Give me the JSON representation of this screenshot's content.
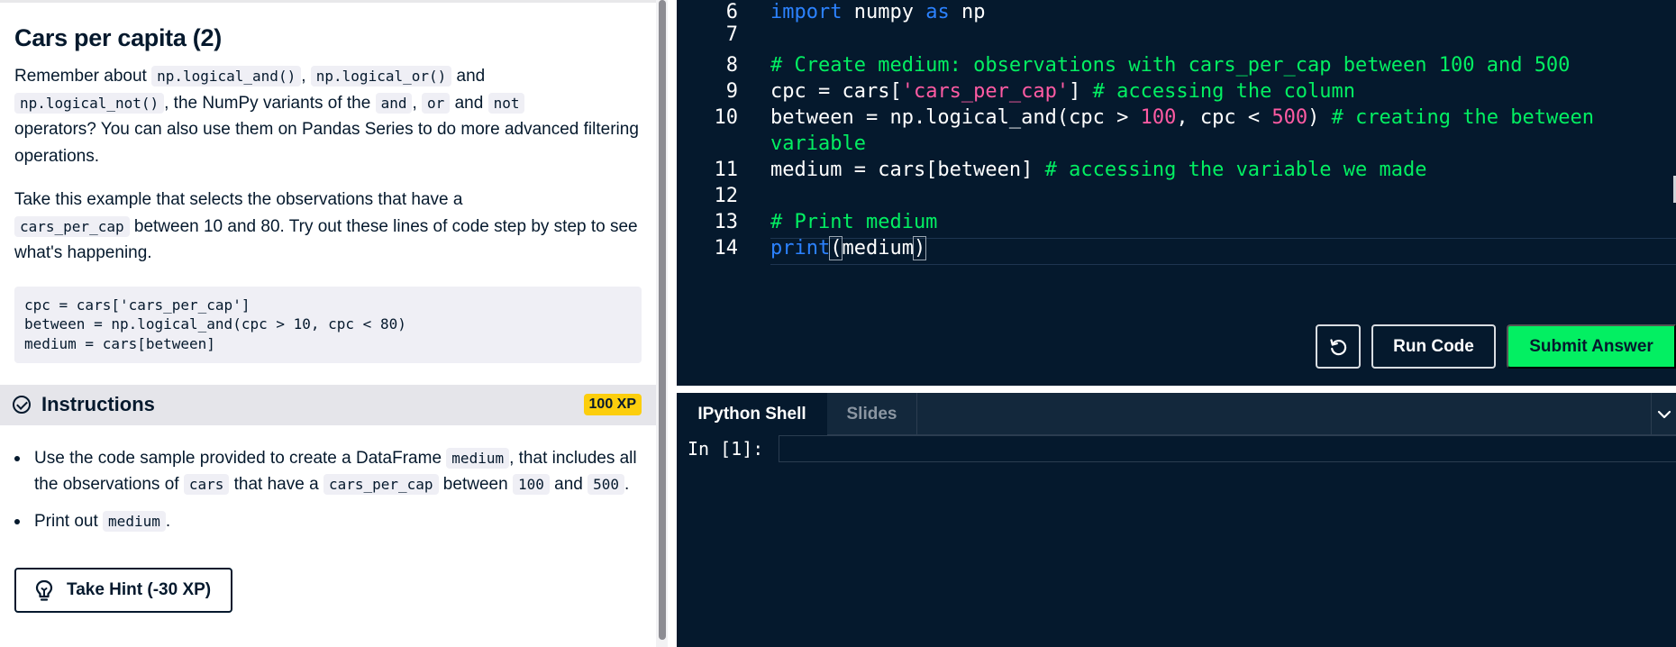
{
  "exercise": {
    "title": "Cars per capita (2)",
    "p1": {
      "t1": "Remember about ",
      "c1": "np.logical_and()",
      "t2": ", ",
      "c2": "np.logical_or()",
      "t3": " and",
      "c3": "np.logical_not()",
      "t4": ", the NumPy variants of the ",
      "c4": "and",
      "t5": ", ",
      "c5": "or",
      "t6": " and ",
      "c6": "not",
      "t7": "operators? You can also use them on Pandas Series to do more advanced filtering operations."
    },
    "p2": {
      "t1": "Take this example that selects the observations that have a",
      "c1": "cars_per_cap",
      "t2": " between 10 and 80. Try out these lines of code step by step to see what's happening."
    },
    "code_sample": "cpc = cars['cars_per_cap']\nbetween = np.logical_and(cpc > 10, cpc < 80)\nmedium = cars[between]"
  },
  "instructions": {
    "label": "Instructions",
    "xp": "100 XP",
    "step1": {
      "t1": "Use the code sample provided to create a DataFrame ",
      "c1": "medium",
      "t2": ", that includes all the observations of ",
      "c2": "cars",
      "t3": " that have a ",
      "c3": "cars_per_cap",
      "t4": " between ",
      "c4": "100",
      "t5": " and ",
      "c5": "500",
      "t6": "."
    },
    "step2": {
      "t1": "Print out ",
      "c1": "medium",
      "t2": "."
    },
    "hint_label": "Take Hint (-30 XP)"
  },
  "editor": {
    "lines": [
      {
        "n": "6",
        "kw1": "import",
        "t1": " numpy ",
        "kw2": "as",
        "t2": " np"
      },
      {
        "n": "7"
      },
      {
        "n": "8",
        "cm": "# Create medium: observations with cars_per_cap between 100 and 500"
      },
      {
        "n": "9",
        "t1": "cpc = cars[",
        "str": "'cars_per_cap'",
        "t2": "] ",
        "cm": "# accessing the column"
      },
      {
        "n": "10",
        "t1": "between = np.logical_and(cpc > ",
        "num1": "100",
        "t2": ", cpc < ",
        "num2": "500",
        "t3": ") ",
        "cm": "# creating the between",
        "wrap": "variable"
      },
      {
        "n": "11",
        "t1": "medium = cars[between] ",
        "cm": "# accessing the variable we made"
      },
      {
        "n": "12"
      },
      {
        "n": "13",
        "cm": "# Print medium"
      },
      {
        "n": "14",
        "kw": "print",
        "p1": "(",
        "t1": "medium",
        "p2": ")"
      }
    ],
    "run_label": "Run Code",
    "submit_label": "Submit Answer"
  },
  "console": {
    "tab_active": "IPython Shell",
    "tab_inactive": "Slides",
    "prompt": "In [1]:"
  },
  "colors": {
    "editor_bg": "#05192d",
    "keyword": "#2c82ff",
    "comment": "#03ef62",
    "string": "#ff5ba3",
    "submit": "#03ef62",
    "xp_badge": "#fcce0d"
  }
}
